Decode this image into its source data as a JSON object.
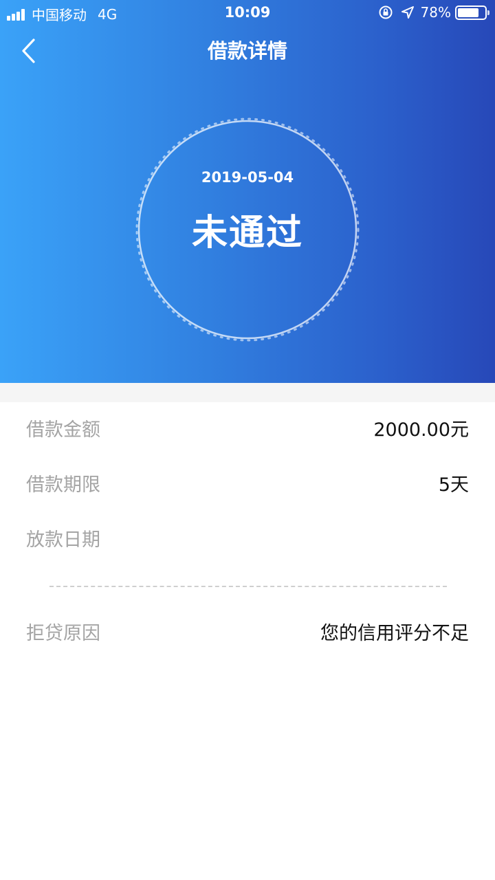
{
  "status_bar": {
    "carrier": "中国移动",
    "network": "4G",
    "time": "10:09",
    "battery_percent": "78%",
    "battery_level": 0.78
  },
  "nav": {
    "title": "借款详情"
  },
  "loan_status": {
    "date": "2019-05-04",
    "status": "未通过"
  },
  "details": [
    {
      "label": "借款金额",
      "value": "2000.00元"
    },
    {
      "label": "借款期限",
      "value": "5天"
    },
    {
      "label": "放款日期",
      "value": ""
    }
  ],
  "rejection": {
    "label": "拒贷原因",
    "value": "您的信用评分不足"
  },
  "colors": {
    "gradient_start": "#3aa2f8",
    "gradient_end": "#2748b8",
    "label_gray": "#a4a4a4",
    "value_black": "#111111"
  }
}
